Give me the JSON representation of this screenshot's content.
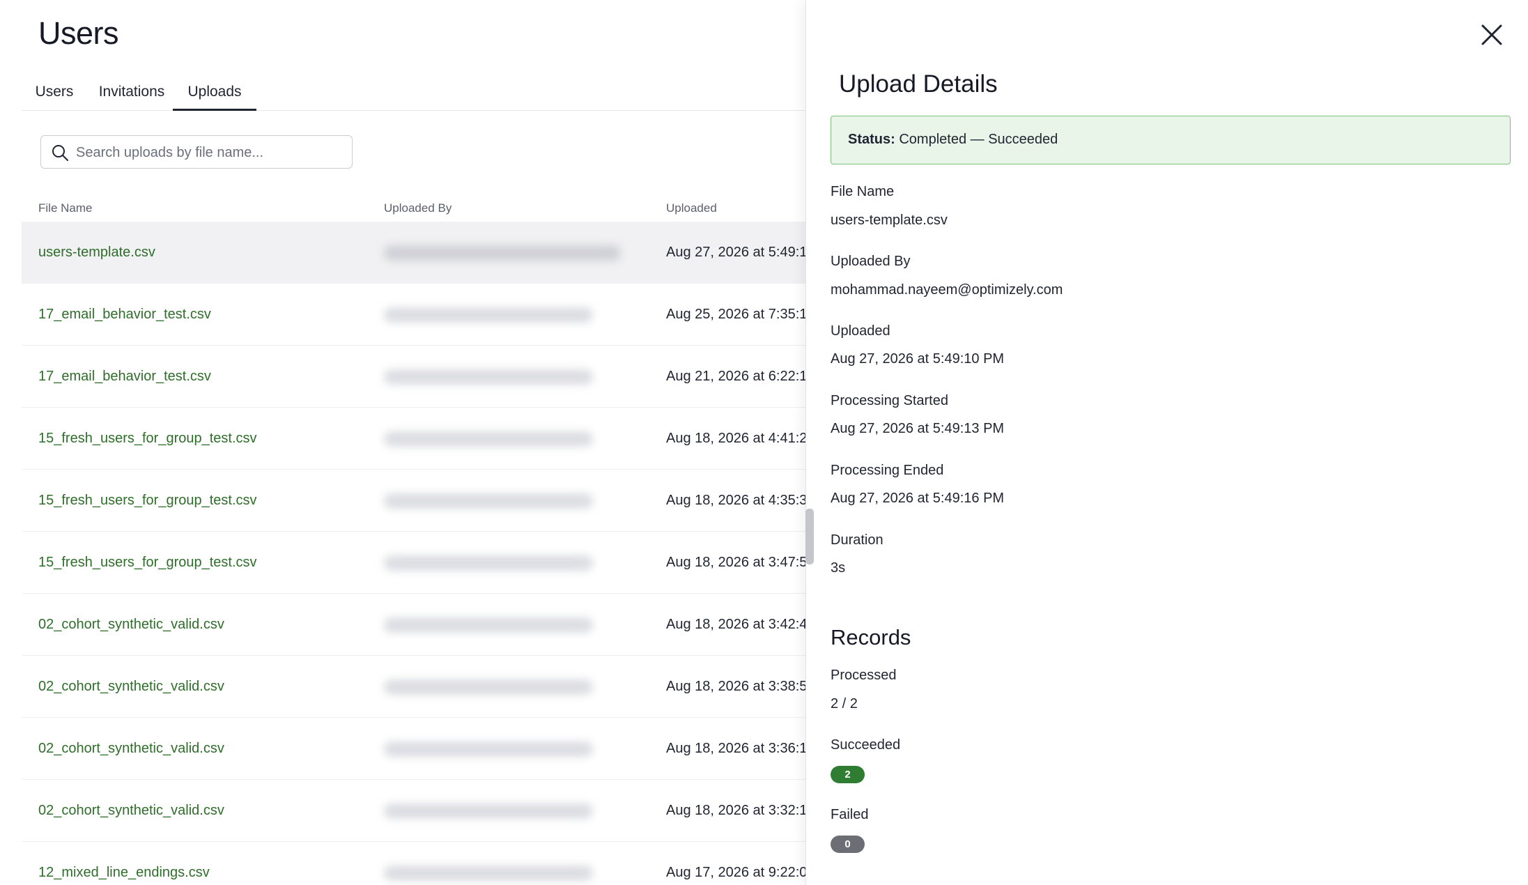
{
  "page": {
    "title": "Users",
    "tabs": [
      "Users",
      "Invitations",
      "Uploads"
    ],
    "active_tab": "Uploads",
    "search_placeholder": "Search uploads by file name..."
  },
  "table": {
    "columns": [
      "File Name",
      "Uploaded By",
      "Uploaded"
    ],
    "rows": [
      {
        "file": "users-template.csv",
        "uploaded": "Aug 27, 2026 at 5:49:1"
      },
      {
        "file": "17_email_behavior_test.csv",
        "uploaded": "Aug 25, 2026 at 7:35:1"
      },
      {
        "file": "17_email_behavior_test.csv",
        "uploaded": "Aug 21, 2026 at 6:22:1"
      },
      {
        "file": "15_fresh_users_for_group_test.csv",
        "uploaded": "Aug 18, 2026 at 4:41:2"
      },
      {
        "file": "15_fresh_users_for_group_test.csv",
        "uploaded": "Aug 18, 2026 at 4:35:3"
      },
      {
        "file": "15_fresh_users_for_group_test.csv",
        "uploaded": "Aug 18, 2026 at 3:47:5"
      },
      {
        "file": "02_cohort_synthetic_valid.csv",
        "uploaded": "Aug 18, 2026 at 3:42:4"
      },
      {
        "file": "02_cohort_synthetic_valid.csv",
        "uploaded": "Aug 18, 2026 at 3:38:5"
      },
      {
        "file": "02_cohort_synthetic_valid.csv",
        "uploaded": "Aug 18, 2026 at 3:36:1"
      },
      {
        "file": "02_cohort_synthetic_valid.csv",
        "uploaded": "Aug 18, 2026 at 3:32:1"
      },
      {
        "file": "12_mixed_line_endings.csv",
        "uploaded": "Aug 17, 2026 at 9:22:0"
      }
    ]
  },
  "details": {
    "title": "Upload Details",
    "status_label": "Status:",
    "status_value": "Completed — Succeeded",
    "file_name_label": "File Name",
    "file_name": "users-template.csv",
    "uploaded_by_label": "Uploaded By",
    "uploaded_by": "mohammad.nayeem@optimizely.com",
    "uploaded_label": "Uploaded",
    "uploaded": "Aug 27, 2026 at 5:49:10 PM",
    "processing_started_label": "Processing Started",
    "processing_started": "Aug 27, 2026 at 5:49:13 PM",
    "processing_ended_label": "Processing Ended",
    "processing_ended": "Aug 27, 2026 at 5:49:16 PM",
    "duration_label": "Duration",
    "duration": "3s"
  },
  "records": {
    "title": "Records",
    "processed_label": "Processed",
    "processed": "2 / 2",
    "succeeded_label": "Succeeded",
    "succeeded": "2",
    "failed_label": "Failed",
    "failed": "0"
  },
  "colors": {
    "link_green": "#2f6e2a",
    "success_bg": "#e9f5e8",
    "success_border": "#7dc077",
    "succeeded_pill": "#2e7d32",
    "failed_pill": "#6b6e74"
  },
  "icons": {
    "search": "search-icon",
    "close": "close-icon"
  }
}
